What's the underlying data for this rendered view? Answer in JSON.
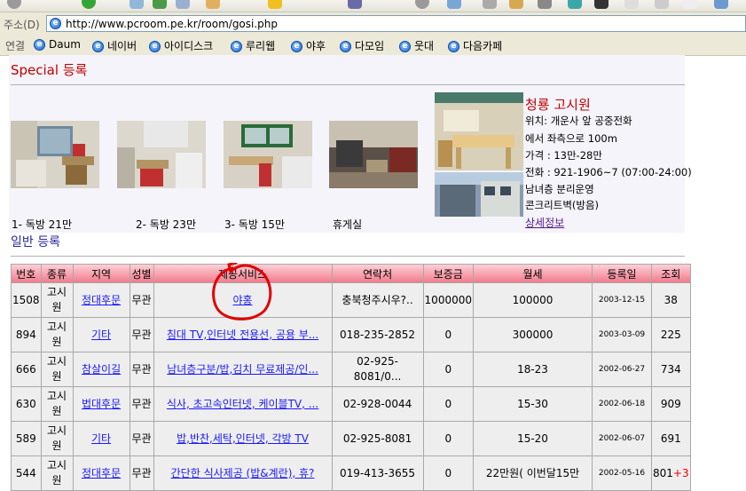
{
  "browser": {
    "address_label": "주소(D)",
    "url": "http://www.pcroom.pe.kr/room/gosi.php",
    "links_label": "연결",
    "links": [
      "Daum",
      "네이버",
      "아이디스크",
      "루리웹",
      "야후",
      "다모임",
      "웃대",
      "다음카페"
    ],
    "colors": {
      "toolbar": "#ece9d8"
    }
  },
  "special": {
    "title": "Special 등록",
    "photos": [
      {
        "caption": "1- 독방 21만"
      },
      {
        "caption": "2- 독방 23만"
      },
      {
        "caption": "3- 독방 15만"
      },
      {
        "caption": "휴게실"
      }
    ],
    "featured": {
      "name": "청룡 고시원",
      "lines": [
        "위치: 개운사 앞 공중전화",
        "에서 좌측으로 100m",
        "가격 : 13만-28만",
        "전화 : 921-1906~7 (07:00-24:00)",
        "남녀층 분리운영",
        "콘크리트벽(방음)"
      ],
      "detail_link": "상세정보"
    }
  },
  "general": {
    "title": "일반 등록",
    "headers": [
      "번호",
      "종류",
      "지역",
      "성별",
      "제공서비스",
      "연락처",
      "보증금",
      "월세",
      "등록일",
      "조회"
    ],
    "rows": [
      {
        "no": "1508",
        "type": "고시원",
        "area": "정대후문",
        "sex": "무관",
        "service": "야홍",
        "contact": "충북청주시우?..",
        "deposit": "1000000",
        "rent": "100000",
        "date": "2003-12-15",
        "views": "38"
      },
      {
        "no": "894",
        "type": "고시원",
        "area": "기타",
        "sex": "무관",
        "service": "침대 TV,인터넷 전용선, 공용 부...",
        "contact": "018-235-2852",
        "deposit": "0",
        "rent": "300000",
        "date": "2003-03-09",
        "views": "225"
      },
      {
        "no": "666",
        "type": "고시원",
        "area": "참살이길",
        "sex": "무관",
        "service": "남녀층구분/밥,김치 무료제공/인...",
        "contact": "02-925-8081/0...",
        "deposit": "0",
        "rent": "18-23",
        "date": "2002-06-27",
        "views": "734"
      },
      {
        "no": "630",
        "type": "고시원",
        "area": "법대후문",
        "sex": "무관",
        "service": "식사, 초고속인터넷, 케이블TV, ...",
        "contact": "02-928-0044",
        "deposit": "0",
        "rent": "15-30",
        "date": "2002-06-18",
        "views": "909"
      },
      {
        "no": "589",
        "type": "고시원",
        "area": "기타",
        "sex": "무관",
        "service": "밥,반찬,세탁,인터넷, 각방 TV",
        "contact": "02-925-8081",
        "deposit": "0",
        "rent": "15-20",
        "date": "2002-06-07",
        "views": "691"
      },
      {
        "no": "544",
        "type": "고시원",
        "area": "정대후문",
        "sex": "무관",
        "service": "간단한 식사제공 (밥&계란), 휴?",
        "contact": "019-413-3655",
        "deposit": "0",
        "rent": "22만원( 이번달15만",
        "date": "2002-05-16",
        "views": "801",
        "views_extra": "+3"
      }
    ]
  }
}
